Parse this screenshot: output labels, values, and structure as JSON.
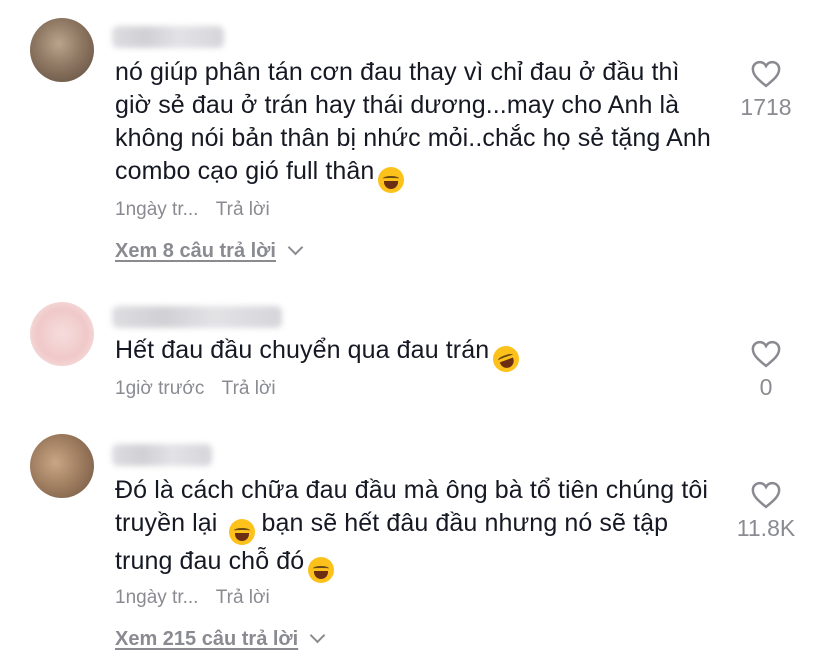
{
  "comments": [
    {
      "text": "nó giúp phân tán cơn đau thay vì chỉ đau ở đầu thì giờ sẻ đau ở trán hay thái dương...may cho Anh là không nói bản thân bị nhức mỏi..chắc họ sẻ tặng Anh combo cạo gió full thân",
      "emoji": "😂",
      "time": "1ngày tr...",
      "reply_label": "Trả lời",
      "likes": "1718",
      "view_replies": "Xem 8 câu trả lời"
    },
    {
      "text": "Hết đau đầu chuyển qua đau trán",
      "emoji": "🤣",
      "time": "1giờ trước",
      "reply_label": "Trả lời",
      "likes": "0"
    },
    {
      "text_before": "Đó là cách chữa đau đầu mà ông bà tổ tiên chúng tôi truyền lại",
      "emoji_mid": "😂",
      "text_after": "bạn sẽ hết đâu đầu nhưng nó sẽ tập trung đau chỗ đó",
      "emoji": "😂",
      "time": "1ngày tr...",
      "reply_label": "Trả lời",
      "likes": "11.8K",
      "view_replies": "Xem 215 câu trả lời"
    }
  ],
  "icons": {
    "like": "heart-outline-icon",
    "expand": "chevron-down-icon",
    "emoji_laugh": "face-with-tears-of-joy-icon",
    "emoji_rofl": "rolling-on-floor-laughing-icon"
  },
  "colors": {
    "text": "#161823",
    "secondary": "#8a8b91",
    "background": "#ffffff"
  }
}
